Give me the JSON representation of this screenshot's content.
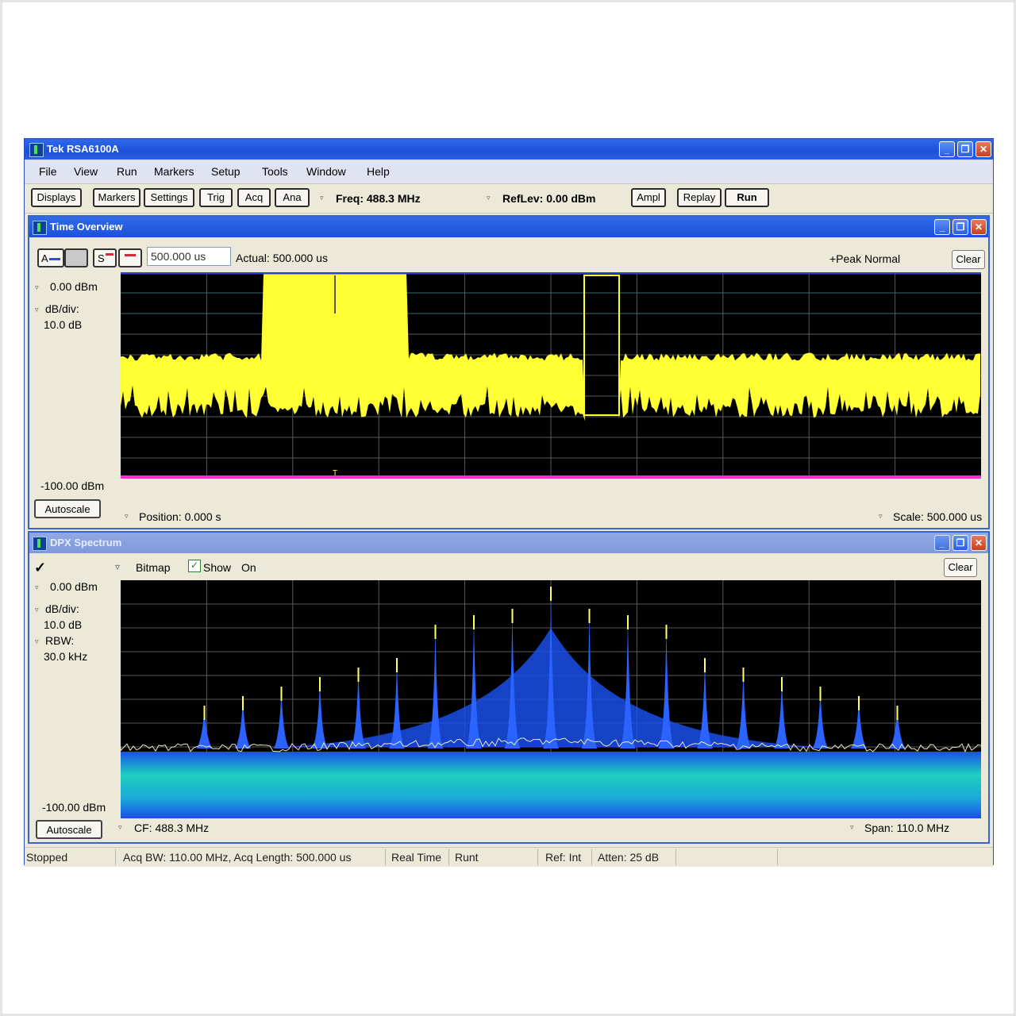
{
  "window": {
    "title": "Tek RSA6100A"
  },
  "menu": [
    "File",
    "View",
    "Run",
    "Markers",
    "Setup",
    "Tools",
    "Window",
    "Help"
  ],
  "toolbar": {
    "displays": "Displays",
    "markers": "Markers",
    "settings": "Settings",
    "trig": "Trig",
    "acq": "Acq",
    "ana": "Ana",
    "freq": "Freq: 488.3 MHz",
    "reflev": "RefLev: 0.00 dBm",
    "ampl": "Ampl",
    "replay": "Replay",
    "run": "Run"
  },
  "time_overview": {
    "title": "Time Overview",
    "trace_a": "A",
    "trace_s": "S",
    "acq_length": "500.000 us",
    "actual": "Actual:  500.000 us",
    "detection": "+Peak Normal",
    "clear": "Clear",
    "ref_level": "0.00 dBm",
    "db_div_label": "dB/div:",
    "db_div": "10.0 dB",
    "bottom_level": "-100.00 dBm",
    "autoscale": "Autoscale",
    "position": "Position: 0.000 s",
    "scale": "Scale: 500.000 us",
    "trigger_marker": "T"
  },
  "dpx": {
    "title": "DPX Spectrum",
    "check": "✓",
    "bitmap": "Bitmap",
    "show": "Show",
    "on": "On",
    "clear": "Clear",
    "ref_level": "0.00 dBm",
    "db_div_label": "dB/div:",
    "db_div": "10.0 dB",
    "rbw_label": "RBW:",
    "rbw": "30.0 kHz",
    "bottom_level": "-100.00 dBm",
    "autoscale": "Autoscale",
    "cf": "CF: 488.3 MHz",
    "span": "Span: 110.0 MHz"
  },
  "status": {
    "state": "Stopped",
    "acq": "Acq BW: 110.00 MHz, Acq Length: 500.000 us",
    "mode": "Real Time",
    "runt": "Runt",
    "ref": "Ref: Int",
    "atten": "Atten: 25 dB"
  },
  "colors": {
    "title_blue": "#1c50d8",
    "trace_yellow": "#ffff33",
    "plot_bg": "#000000",
    "dpx_blue": "#1a4fe8",
    "dpx_cyan": "#1fd0c0",
    "marker_magenta": "#ff2bd6"
  }
}
